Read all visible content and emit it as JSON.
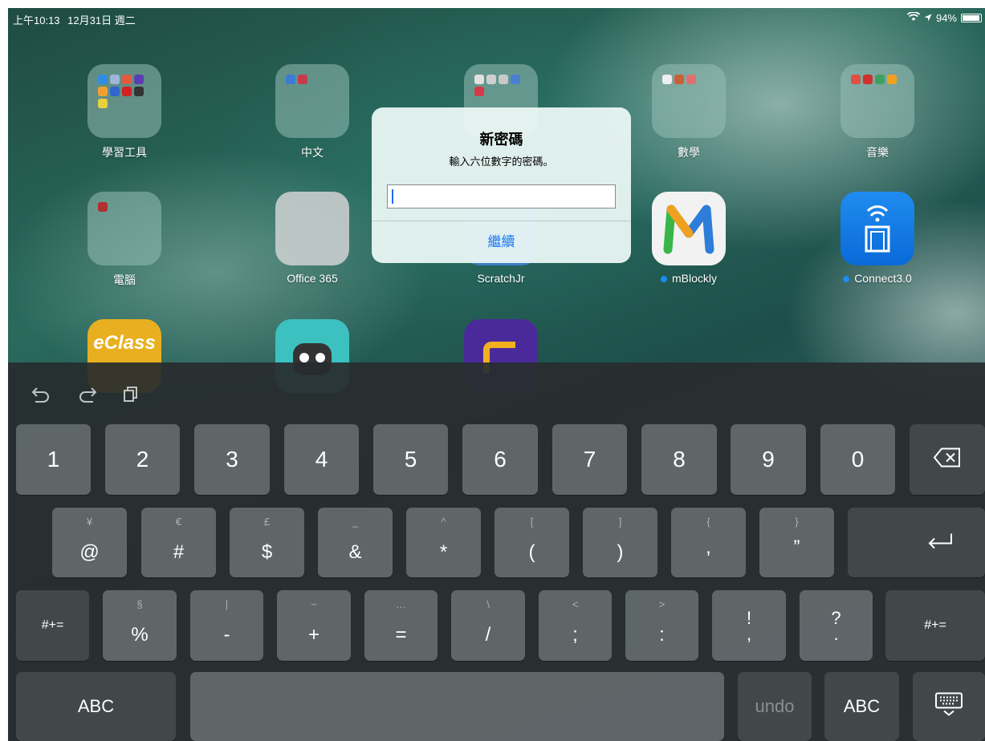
{
  "status_bar": {
    "time": "上午10:13",
    "date": "12月31日 週二",
    "battery": "94%"
  },
  "apps": [
    {
      "label": "學習工具",
      "has_dot": false
    },
    {
      "label": "中文",
      "has_dot": false
    },
    {
      "label": "",
      "has_dot": false
    },
    {
      "label": "數學",
      "has_dot": false
    },
    {
      "label": "音樂",
      "has_dot": false
    },
    {
      "label": "電腦",
      "has_dot": false
    },
    {
      "label": "Office 365",
      "has_dot": false
    },
    {
      "label": "ScratchJr",
      "has_dot": false
    },
    {
      "label": "mBlockly",
      "has_dot": true
    },
    {
      "label": "Connect3.0",
      "has_dot": true
    },
    {
      "label": "eClass",
      "has_dot": false
    }
  ],
  "dialog": {
    "title": "新密碼",
    "message": "輸入六位數字的密碼。",
    "input_value": "",
    "button": "繼續"
  },
  "keyboard": {
    "toolbar": [
      "undo-icon",
      "redo-icon",
      "paste-icon"
    ],
    "row1": [
      "1",
      "2",
      "3",
      "4",
      "5",
      "6",
      "7",
      "8",
      "9",
      "0"
    ],
    "row2": [
      {
        "main": "@",
        "alt": "¥"
      },
      {
        "main": "#",
        "alt": "€"
      },
      {
        "main": "$",
        "alt": "£"
      },
      {
        "main": "&",
        "alt": "_"
      },
      {
        "main": "*",
        "alt": "^"
      },
      {
        "main": "(",
        "alt": "["
      },
      {
        "main": ")",
        "alt": "]"
      },
      {
        "main": ",",
        "alt": "{"
      },
      {
        "main": "”",
        "alt": "}"
      }
    ],
    "row3": [
      {
        "main": "%",
        "alt": "§"
      },
      {
        "main": "-",
        "alt": "|"
      },
      {
        "main": "+",
        "alt": "~"
      },
      {
        "main": "=",
        "alt": "…"
      },
      {
        "main": "/",
        "alt": "\\"
      },
      {
        "main": ";",
        "alt": "<"
      },
      {
        "main": ":",
        "alt": ">"
      },
      {
        "main": ",",
        "alt": "!"
      },
      {
        "main": ".",
        "alt": "?"
      }
    ],
    "symbols_key": "#+=",
    "abc_key": "ABC",
    "undo_key": "undo"
  }
}
